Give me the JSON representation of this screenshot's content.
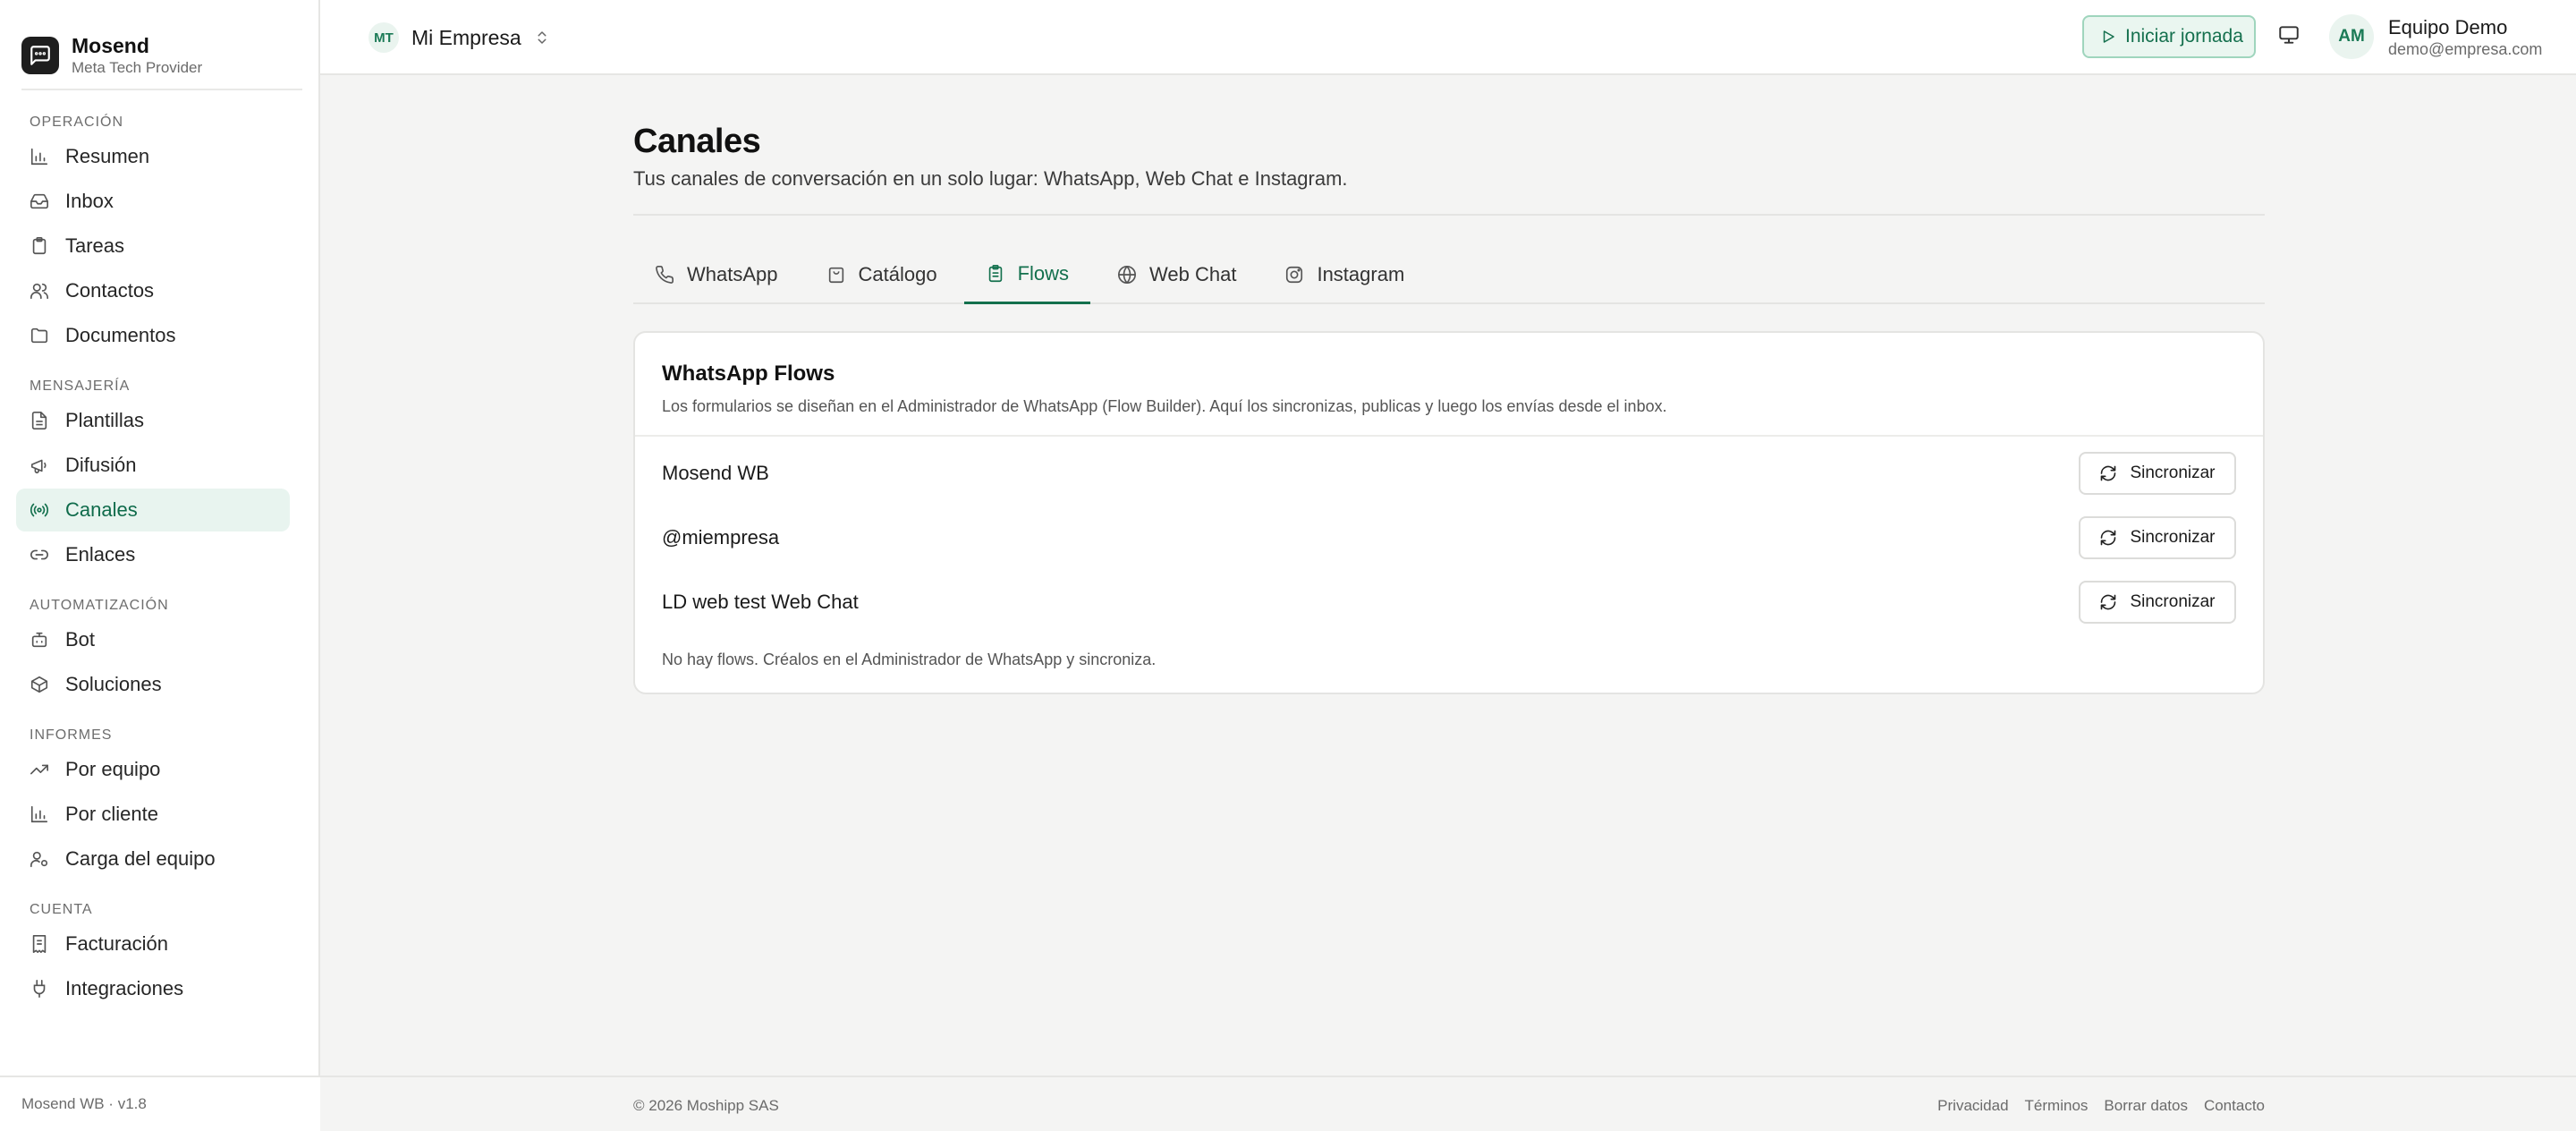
{
  "brand": {
    "name": "Mosend",
    "subtitle": "Meta Tech Provider"
  },
  "sidebar": {
    "sections": [
      {
        "title": "OPERACIÓN",
        "items": [
          {
            "label": "Resumen",
            "icon": "bar-chart-icon"
          },
          {
            "label": "Inbox",
            "icon": "inbox-icon"
          },
          {
            "label": "Tareas",
            "icon": "clipboard-icon"
          },
          {
            "label": "Contactos",
            "icon": "users-icon"
          },
          {
            "label": "Documentos",
            "icon": "folder-icon"
          }
        ]
      },
      {
        "title": "MENSAJERÍA",
        "items": [
          {
            "label": "Plantillas",
            "icon": "file-text-icon"
          },
          {
            "label": "Difusión",
            "icon": "megaphone-icon"
          },
          {
            "label": "Canales",
            "icon": "radio-icon",
            "active": true
          },
          {
            "label": "Enlaces",
            "icon": "link-icon"
          }
        ]
      },
      {
        "title": "AUTOMATIZACIÓN",
        "items": [
          {
            "label": "Bot",
            "icon": "bot-icon"
          },
          {
            "label": "Soluciones",
            "icon": "package-icon"
          }
        ]
      },
      {
        "title": "INFORMES",
        "items": [
          {
            "label": "Por equipo",
            "icon": "trending-up-icon"
          },
          {
            "label": "Por cliente",
            "icon": "bar-chart-icon"
          },
          {
            "label": "Carga del equipo",
            "icon": "user-cog-icon"
          }
        ]
      },
      {
        "title": "CUENTA",
        "items": [
          {
            "label": "Facturación",
            "icon": "receipt-icon"
          },
          {
            "label": "Integraciones",
            "icon": "plug-icon"
          }
        ]
      }
    ],
    "footer": "Mosend WB · v1.8"
  },
  "topbar": {
    "workspace_initials": "MT",
    "workspace_name": "Mi Empresa",
    "start_label": "Iniciar jornada",
    "user_initials": "AM",
    "user_name": "Equipo Demo",
    "user_email": "demo@empresa.com"
  },
  "page": {
    "title": "Canales",
    "subtitle": "Tus canales de conversación en un solo lugar: WhatsApp, Web Chat e Instagram."
  },
  "tabs": [
    {
      "label": "WhatsApp",
      "icon": "phone-icon"
    },
    {
      "label": "Catálogo",
      "icon": "shopping-bag-icon"
    },
    {
      "label": "Flows",
      "icon": "clipboard-list-icon",
      "active": true
    },
    {
      "label": "Web Chat",
      "icon": "globe-icon"
    },
    {
      "label": "Instagram",
      "icon": "instagram-icon"
    }
  ],
  "card": {
    "title": "WhatsApp Flows",
    "description": "Los formularios se diseñan en el Administrador de WhatsApp (Flow Builder). Aquí los sincronizas, publicas y luego los envías desde el inbox.",
    "rows": [
      {
        "label": "Mosend WB",
        "button": "Sincronizar"
      },
      {
        "label": "@miempresa",
        "button": "Sincronizar"
      },
      {
        "label": "LD web test Web Chat",
        "button": "Sincronizar"
      }
    ],
    "empty": "No hay flows. Créalos en el Administrador de WhatsApp y sincroniza."
  },
  "footer": {
    "copyright": "© 2026 Moshipp SAS",
    "links": [
      "Privacidad",
      "Términos",
      "Borrar datos",
      "Contacto"
    ]
  },
  "colors": {
    "accent": "#13704d",
    "accent_bg": "#e8f4ef"
  }
}
